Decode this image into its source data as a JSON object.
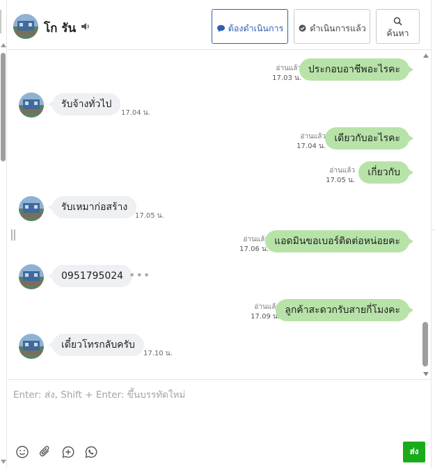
{
  "header": {
    "contact_name": "โก รัน",
    "buttons": {
      "todo_label": "ต้องดำเนินการ",
      "done_label": "ดำเนินการแล้ว",
      "search_label": "ค้นหา"
    }
  },
  "messages": [
    {
      "direction": "out",
      "text": "ประกอบอาชีพอะไรคะ",
      "status": "อ่านแล้ว",
      "time": "17.03 น."
    },
    {
      "direction": "in",
      "text": "รับจ้างทั่วไป",
      "time": "17.04 น."
    },
    {
      "direction": "out",
      "text": "เดียวกับอะไรคะ",
      "status": "อ่านแล้ว",
      "time": "17.04 น."
    },
    {
      "direction": "out",
      "text": "เกี่ยวกับ",
      "status": "อ่านแล้ว",
      "time": "17.05 น."
    },
    {
      "direction": "in",
      "text": "รับเหมาก่อสร้าง",
      "time": "17.05 น."
    },
    {
      "direction": "out",
      "text": "แอดมินขอเบอร์ติดต่อหน่อยคะ",
      "status": "อ่านแล้ว",
      "time": "17.06 น."
    },
    {
      "direction": "in",
      "text": "0951795024",
      "time": ""
    },
    {
      "direction": "out",
      "text": "ลูกค้าสะดวกรับสายกี่โมงคะ",
      "status": "อ่านแล้ว",
      "time": "17.09 น."
    },
    {
      "direction": "in",
      "text": "เดี๋ยวโทรกลับครับ",
      "time": "17.10 น."
    }
  ],
  "composer": {
    "placeholder": "Enter: ส่ง, Shift + Enter: ขึ้นบรรทัดใหม่",
    "value": "",
    "send_label": "ส่ง"
  },
  "colors": {
    "outgoing_bubble": "#b8e3a8",
    "incoming_bubble": "#eef0f3",
    "send_button": "#1aab1a",
    "active_button": "#2f5fb3"
  },
  "icons": {
    "speaker": "speaker-icon",
    "todo": "speech-bubble-icon",
    "done": "chat-check-icon",
    "search": "search-icon",
    "emoji": "emoji-icon",
    "attach": "paperclip-icon",
    "add": "add-chat-icon",
    "call": "phone-icon"
  }
}
